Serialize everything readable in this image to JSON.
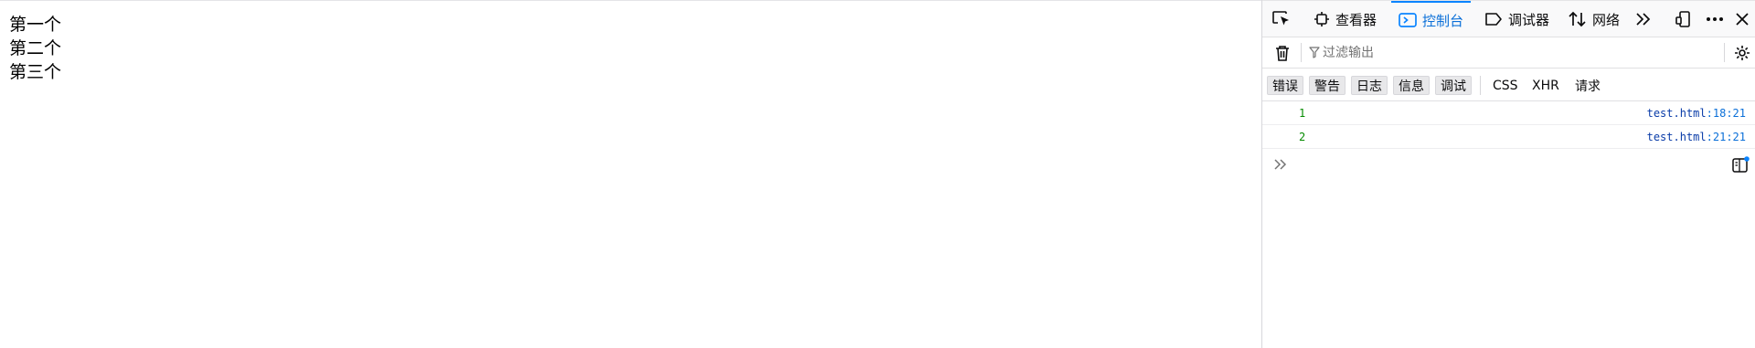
{
  "page": {
    "items": [
      "第一个",
      "第二个",
      "第三个"
    ]
  },
  "devtools": {
    "tabs": [
      {
        "label": "查看器",
        "icon": "inspector-icon",
        "selected": false
      },
      {
        "label": "控制台",
        "icon": "console-icon",
        "selected": true
      },
      {
        "label": "调试器",
        "icon": "debugger-icon",
        "selected": false
      },
      {
        "label": "网络",
        "icon": "network-icon",
        "selected": false
      }
    ],
    "filter": {
      "placeholder": "过滤输出",
      "value": ""
    },
    "categories": [
      {
        "label": "错误",
        "active": true
      },
      {
        "label": "警告",
        "active": true
      },
      {
        "label": "日志",
        "active": true
      },
      {
        "label": "信息",
        "active": true
      },
      {
        "label": "调试",
        "active": true
      },
      {
        "label": "CSS",
        "active": false
      },
      {
        "label": "XHR",
        "active": false
      },
      {
        "label": "请求",
        "active": false
      }
    ],
    "messages": [
      {
        "value": "1",
        "file": "test.html",
        "line": ":18:21"
      },
      {
        "value": "2",
        "file": "test.html",
        "line": ":21:21"
      }
    ],
    "colors": {
      "accent": "#0a84ff",
      "log_value": "#058b00",
      "source_link": "#0a3ca8"
    }
  }
}
